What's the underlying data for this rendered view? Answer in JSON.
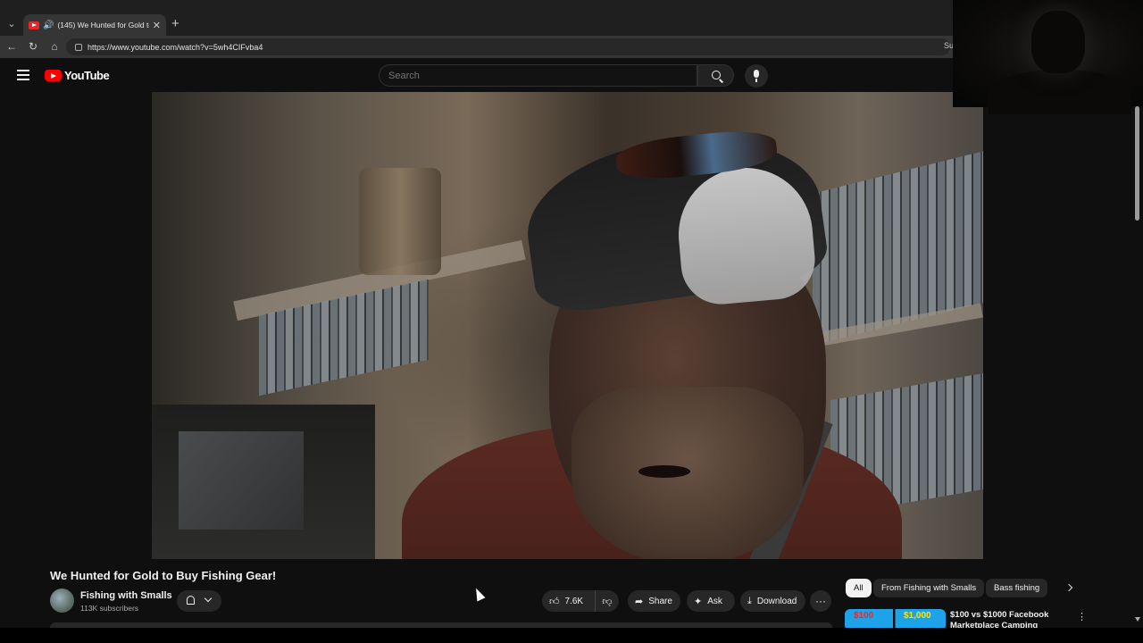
{
  "browser": {
    "tab_title": "(145) We Hunted for Gold to",
    "url": "https://www.youtube.com/watch?v=5wh4CIFvba4",
    "right_partial": "Su"
  },
  "youtube": {
    "logo_text": "YouTube",
    "search_placeholder": "Search"
  },
  "video": {
    "title": "We Hunted for Gold to Buy Fishing Gear!",
    "channel": "Fishing with Smalls",
    "subscribers": "113K subscribers",
    "likes": "7.6K",
    "actions": {
      "share": "Share",
      "ask": "Ask",
      "download": "Download"
    }
  },
  "chips": [
    "All",
    "From Fishing with Smalls",
    "Bass fishing"
  ],
  "recommendation": {
    "thumb_left": "$100",
    "thumb_right": "$1,000",
    "title": "$100 vs $1000 Facebook Marketplace Camping"
  },
  "colors": {
    "background": "#0f0f0f",
    "brand_red": "#ff0000",
    "pill": "#272727"
  }
}
